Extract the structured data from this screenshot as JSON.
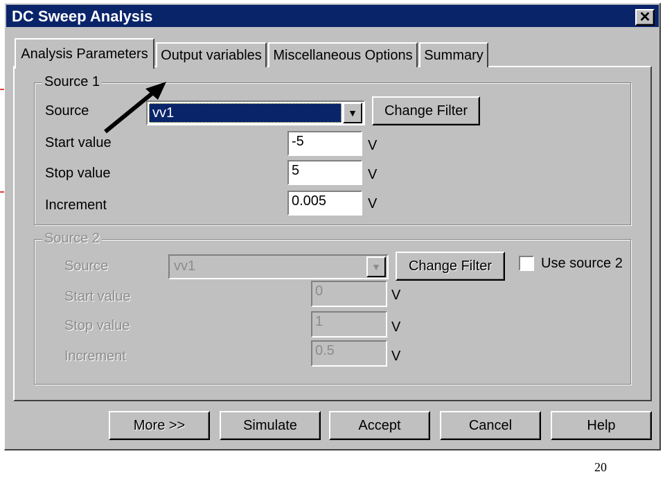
{
  "window": {
    "title": "DC Sweep Analysis"
  },
  "tabs": [
    {
      "label": "Analysis Parameters"
    },
    {
      "label": "Output variables"
    },
    {
      "label": "Miscellaneous Options"
    },
    {
      "label": "Summary"
    }
  ],
  "source1": {
    "group_title": "Source 1",
    "source_label": "Source",
    "source_value": "vv1",
    "change_filter": "Change Filter",
    "start_label": "Start value",
    "start_value": "-5",
    "stop_label": "Stop value",
    "stop_value": "5",
    "increment_label": "Increment",
    "increment_value": "0.005",
    "unit": "V"
  },
  "source2": {
    "group_title": "Source 2",
    "source_label": "Source",
    "source_value": "vv1",
    "change_filter": "Change Filter",
    "use_source_label": "Use source 2",
    "use_source_checked": false,
    "start_label": "Start value",
    "start_value": "0",
    "stop_label": "Stop value",
    "stop_value": "1",
    "increment_label": "Increment",
    "increment_value": "0.5",
    "unit": "V"
  },
  "buttons": {
    "more": "More >>",
    "simulate": "Simulate",
    "accept": "Accept",
    "cancel": "Cancel",
    "help": "Help"
  },
  "slide_number": "20",
  "colors": {
    "title_bar": "#0a246a",
    "dialog_bg": "#c0c0c0",
    "selection": "#0a246a",
    "disabled_text": "#8c8c8c"
  }
}
